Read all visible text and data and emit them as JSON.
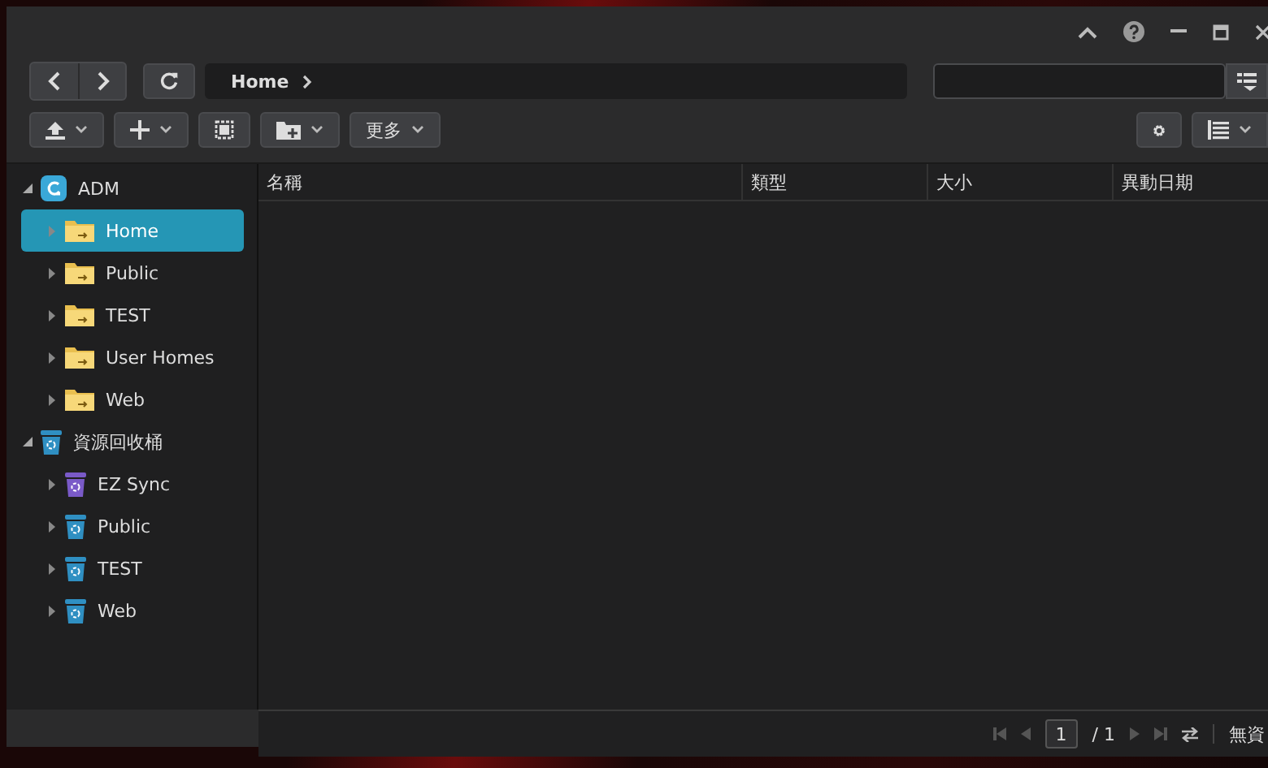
{
  "breadcrumb": [
    {
      "label": "Home"
    }
  ],
  "toolbar": {
    "more_label": "更多"
  },
  "tree": [
    {
      "label": "ADM",
      "kind": "volume",
      "expanded": true,
      "selected": false,
      "children": [
        {
          "label": "Home",
          "kind": "folder",
          "expanded": false,
          "selected": true
        },
        {
          "label": "Public",
          "kind": "folder",
          "expanded": false,
          "selected": false
        },
        {
          "label": "TEST",
          "kind": "folder",
          "expanded": false,
          "selected": false
        },
        {
          "label": "User Homes",
          "kind": "folder",
          "expanded": false,
          "selected": false
        },
        {
          "label": "Web",
          "kind": "folder",
          "expanded": false,
          "selected": false
        }
      ]
    },
    {
      "label": "資源回收桶",
      "kind": "recycle",
      "color": "#2f8fc2",
      "expanded": true,
      "selected": false,
      "children": [
        {
          "label": "EZ Sync",
          "kind": "recycle",
          "color": "#7a5ac8",
          "expanded": false,
          "selected": false
        },
        {
          "label": "Public",
          "kind": "recycle",
          "color": "#2f8fc2",
          "expanded": false,
          "selected": false
        },
        {
          "label": "TEST",
          "kind": "recycle",
          "color": "#2f8fc2",
          "expanded": false,
          "selected": false
        },
        {
          "label": "Web",
          "kind": "recycle",
          "color": "#2f8fc2",
          "expanded": false,
          "selected": false
        }
      ]
    }
  ],
  "table": {
    "columns": [
      "名稱",
      "類型",
      "大小",
      "異動日期"
    ]
  },
  "pager": {
    "page": "1",
    "total": "/ 1",
    "status": "無資"
  }
}
